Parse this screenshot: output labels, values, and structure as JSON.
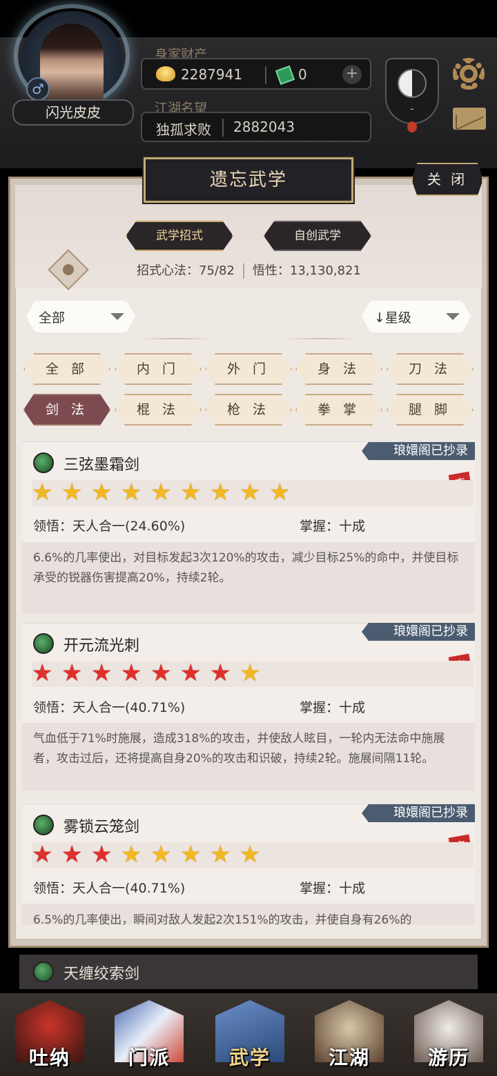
{
  "player": {
    "name": "闪光皮皮",
    "gender_symbol": "♂",
    "wealth_label": "身家财产",
    "gold": "2287941",
    "jade": "0",
    "plus": "+",
    "fame_label": "江湖名望",
    "fame_title": "独孤求败",
    "fame_value": "2882043",
    "taiji_value": "-"
  },
  "panel": {
    "title": "遗忘武学",
    "close_label": "关 闭",
    "tab_moves": "武学招式",
    "tab_selfmade": "自创武学",
    "stats_moves_label": "招式心法：",
    "stats_moves_value": "75/82",
    "stats_insight_label": "悟性：",
    "stats_insight_value": "13,130,821",
    "filter_left": "全部",
    "filter_right": "↓星级"
  },
  "categories": [
    "全 部",
    "内 门",
    "外 门",
    "身 法",
    "刀 法",
    "剑 法",
    "棍 法",
    "枪 法",
    "拳 掌",
    "腿 脚"
  ],
  "active_category": "剑 法",
  "skills": [
    {
      "name": "三弦墨霜剑",
      "tag": "琅嬛阁已抄录",
      "seal": "忘",
      "stars": [
        "gold",
        "gold",
        "gold",
        "gold",
        "gold",
        "gold",
        "gold",
        "gold",
        "gold"
      ],
      "insight_label": "领悟：",
      "insight_value": "天人合一(24.60%)",
      "mastery_label": "掌握：",
      "mastery_value": "十成",
      "desc": "6.6%的几率使出，对目标发起3次120%的攻击，减少目标25%的命中，并使目标承受的锐器伤害提高20%，持续2轮。"
    },
    {
      "name": "开元流光刺",
      "tag": "琅嬛阁已抄录",
      "seal": "忘",
      "stars": [
        "red",
        "red",
        "red",
        "red",
        "red",
        "red",
        "red",
        "gold"
      ],
      "insight_label": "领悟：",
      "insight_value": "天人合一(40.71%)",
      "mastery_label": "掌握：",
      "mastery_value": "十成",
      "desc": "气血低于71%时施展，造成318%的攻击，并使敌人眩目，一轮内无法命中施展者，攻击过后，还将提高自身20%的攻击和识破，持续2轮。施展间隔11轮。"
    },
    {
      "name": "雾锁云笼剑",
      "tag": "琅嬛阁已抄录",
      "seal": "忘",
      "stars": [
        "red",
        "red",
        "red",
        "gold",
        "gold",
        "gold",
        "gold",
        "gold"
      ],
      "insight_label": "领悟：",
      "insight_value": "天人合一(40.71%)",
      "mastery_label": "掌握：",
      "mastery_value": "十成",
      "desc": "6.5%的几率使出，瞬间对敌人发起2次151%的攻击，并使自身有26%的"
    }
  ],
  "peek_skill": "天缠绞索剑",
  "nav": [
    "吐纳",
    "门派",
    "武学",
    "江湖",
    "游历"
  ],
  "colors": {
    "accent_gold": "#c5a878",
    "tag_blue": "#4c5c70",
    "active_category": "#7d4b4f",
    "star_gold": "#f2b824",
    "star_red": "#e0302c"
  }
}
